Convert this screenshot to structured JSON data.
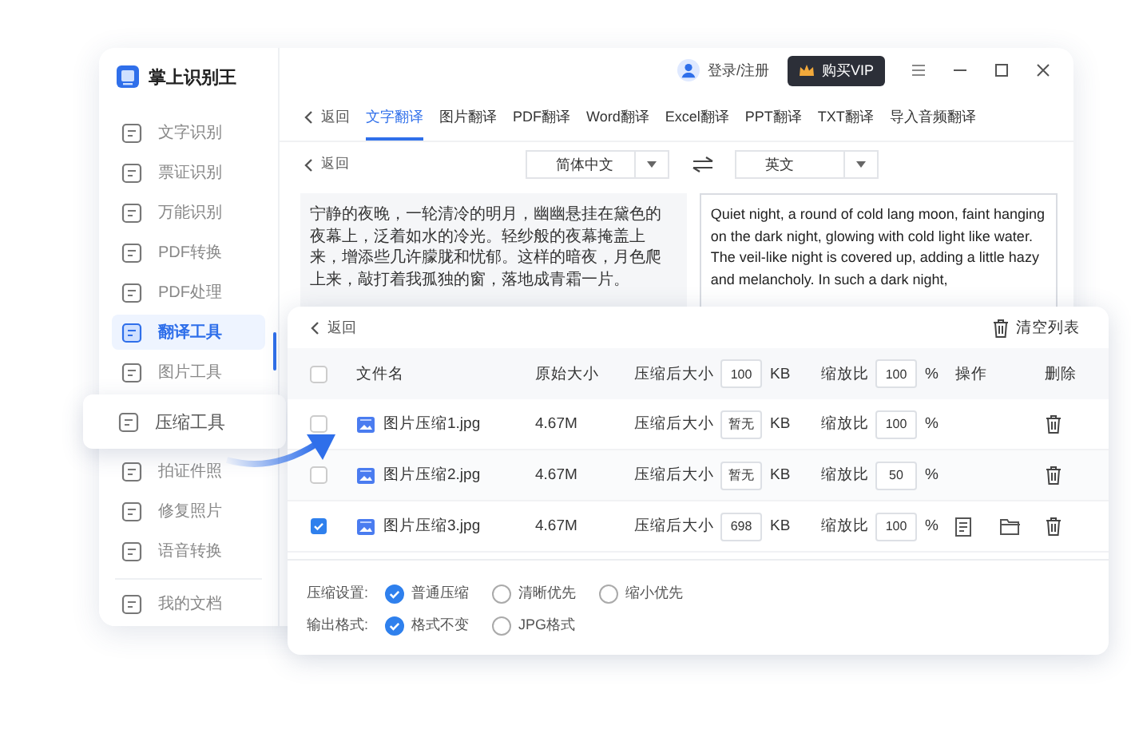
{
  "app": {
    "title": "掌上识别王"
  },
  "sidebar": {
    "items": [
      {
        "label": "文字识别",
        "selected": false,
        "kind": "item"
      },
      {
        "label": "票证识别",
        "selected": false,
        "kind": "item"
      },
      {
        "label": "万能识别",
        "selected": false,
        "kind": "item"
      },
      {
        "label": "PDF转换",
        "selected": false,
        "kind": "item"
      },
      {
        "label": "PDF处理",
        "selected": false,
        "kind": "item"
      },
      {
        "label": "翻译工具",
        "selected": true,
        "kind": "item"
      },
      {
        "label": "图片工具",
        "selected": false,
        "kind": "item"
      },
      {
        "label": "压缩工具",
        "selected": false,
        "kind": "popout"
      },
      {
        "label": "拍证件照",
        "selected": false,
        "kind": "item"
      },
      {
        "label": "修复照片",
        "selected": false,
        "kind": "item"
      },
      {
        "label": "语音转换",
        "selected": false,
        "kind": "item"
      }
    ],
    "footer_item": {
      "label": "我的文档"
    }
  },
  "top_bar": {
    "login": "登录/注册",
    "vip_button": "购买VIP"
  },
  "tabs": [
    {
      "label": "返回",
      "kind": "back"
    },
    {
      "label": "文字翻译",
      "kind": "tab",
      "selected": true
    },
    {
      "label": "图片翻译",
      "kind": "tab",
      "selected": false
    },
    {
      "label": "PDF翻译",
      "kind": "tab",
      "selected": false
    },
    {
      "label": "Word翻译",
      "kind": "tab",
      "selected": false
    },
    {
      "label": "Excel翻译",
      "kind": "tab",
      "selected": false
    },
    {
      "label": "PPT翻译",
      "kind": "tab",
      "selected": false
    },
    {
      "label": "TXT翻译",
      "kind": "tab",
      "selected": false
    },
    {
      "label": "导入音频翻译",
      "kind": "tab",
      "selected": false
    }
  ],
  "translate": {
    "back": "返回",
    "source_language": "简体中文",
    "target_language": "英文",
    "source_text": "宁静的夜晚，一轮清冷的明月，幽幽悬挂在黛色的夜幕上，泛着如水的冷光。轻纱般的夜幕掩盖上来，增添些几许朦胧和忧郁。这样的暗夜，月色爬上来，敲打着我孤独的窗，落地成青霜一片。",
    "target_text": "Quiet night, a round of cold lang moon, faint hanging on the dark night, glowing with cold light like water. The veil-like night is covered up, adding a little hazy and melancholy. In such a dark night,"
  },
  "compress_panel": {
    "back": "返回",
    "clear_button": "清空列表",
    "header": {
      "checked": false,
      "name": "文件名",
      "size": "原始大小",
      "compressed_label": "压缩后大小",
      "compressed_value": "100",
      "compressed_unit": "KB",
      "scale_label": "缩放比",
      "scale_value": "100",
      "scale_unit": "%",
      "actions": "操作",
      "delete": "删除"
    },
    "rows": [
      {
        "checked": false,
        "name": "图片压缩1.jpg",
        "size": "4.67M",
        "compressed_label": "压缩后大小",
        "compressed_value": "暂无",
        "compressed_unit": "KB",
        "scale_label": "缩放比",
        "scale_value": "100",
        "scale_unit": "%",
        "actions": false
      },
      {
        "checked": false,
        "name": "图片压缩2.jpg",
        "size": "4.67M",
        "compressed_label": "压缩后大小",
        "compressed_value": "暂无",
        "compressed_unit": "KB",
        "scale_label": "缩放比",
        "scale_value": "50",
        "scale_unit": "%",
        "actions": false
      },
      {
        "checked": true,
        "name": "图片压缩3.jpg",
        "size": "4.67M",
        "compressed_label": "压缩后大小",
        "compressed_value": "698",
        "compressed_unit": "KB",
        "scale_label": "缩放比",
        "scale_value": "100",
        "scale_unit": "%",
        "actions": true
      }
    ],
    "settings": [
      {
        "label": "压缩设置:",
        "options": [
          {
            "label": "普通压缩",
            "selected": true
          },
          {
            "label": "清晰优先",
            "selected": false
          },
          {
            "label": "缩小优先",
            "selected": false
          }
        ]
      },
      {
        "label": "输出格式:",
        "options": [
          {
            "label": "格式不变",
            "selected": true
          },
          {
            "label": "JPG格式",
            "selected": false
          }
        ]
      }
    ]
  }
}
